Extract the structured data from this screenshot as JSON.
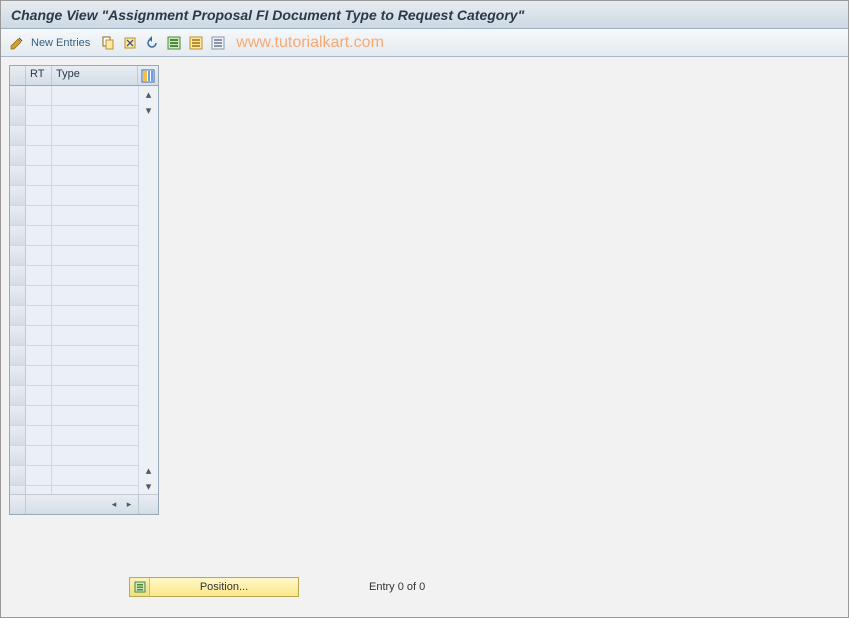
{
  "title": "Change View \"Assignment Proposal FI Document Type to Request Category\"",
  "toolbar": {
    "new_entries_label": "New Entries"
  },
  "watermark": "www.tutorialkart.com",
  "table": {
    "columns": {
      "rt": "RT",
      "type": "Type"
    },
    "row_count": 21
  },
  "footer": {
    "position_label": "Position...",
    "entry_text": "Entry 0 of 0"
  },
  "icons": {
    "cfg": "config-columns-icon"
  }
}
